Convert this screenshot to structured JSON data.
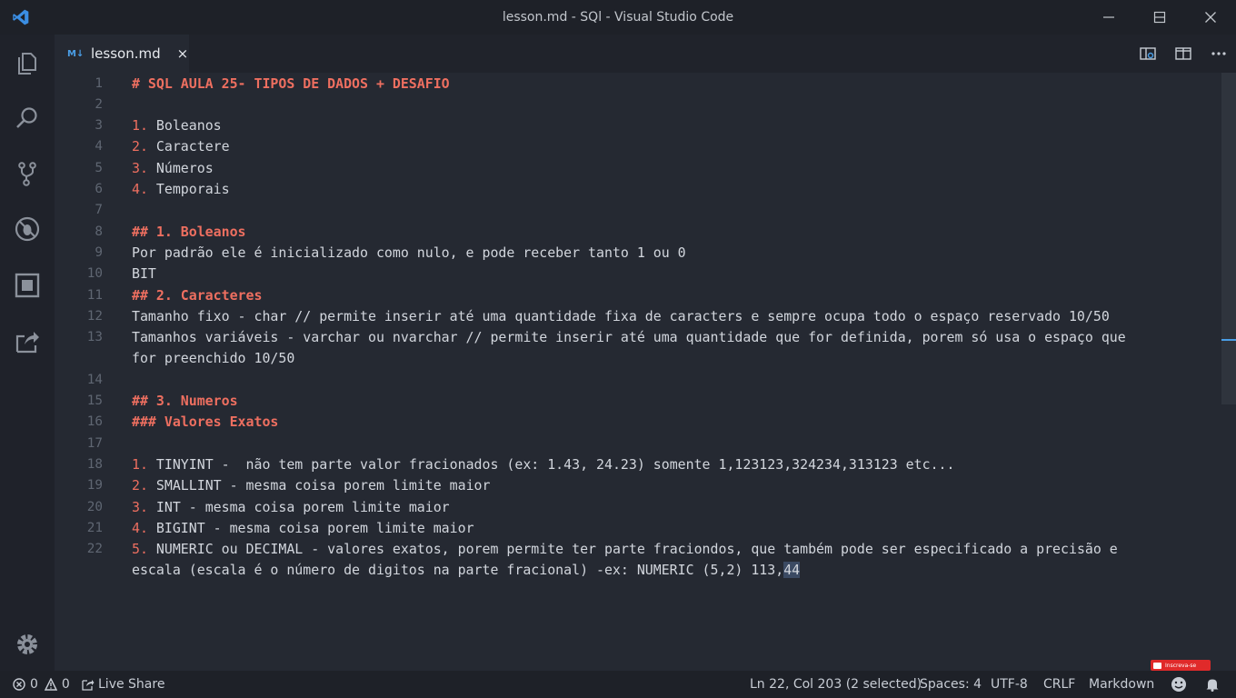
{
  "window": {
    "title": "lesson.md - SQl - Visual Studio Code"
  },
  "tab": {
    "icon": "M↓",
    "label": "lesson.md",
    "close": "×"
  },
  "lines": [
    {
      "n": "1",
      "segs": [
        {
          "t": "# SQL AULA 25- TIPOS DE DADOS + DESAFIO",
          "c": "hd"
        }
      ]
    },
    {
      "n": "2",
      "segs": []
    },
    {
      "n": "3",
      "segs": [
        {
          "t": "1.",
          "c": "lm"
        },
        {
          "t": " Boleanos",
          "c": ""
        }
      ]
    },
    {
      "n": "4",
      "segs": [
        {
          "t": "2.",
          "c": "lm"
        },
        {
          "t": " Caractere",
          "c": ""
        }
      ]
    },
    {
      "n": "5",
      "segs": [
        {
          "t": "3.",
          "c": "lm"
        },
        {
          "t": " Números",
          "c": ""
        }
      ]
    },
    {
      "n": "6",
      "segs": [
        {
          "t": "4.",
          "c": "lm"
        },
        {
          "t": " Temporais",
          "c": ""
        }
      ]
    },
    {
      "n": "7",
      "segs": []
    },
    {
      "n": "8",
      "segs": [
        {
          "t": "## 1. Boleanos",
          "c": "hd"
        }
      ]
    },
    {
      "n": "9",
      "segs": [
        {
          "t": "Por padrão ele é inicializado como nulo, e pode receber tanto 1 ou 0",
          "c": ""
        }
      ]
    },
    {
      "n": "10",
      "segs": [
        {
          "t": "BIT",
          "c": ""
        }
      ]
    },
    {
      "n": "11",
      "segs": [
        {
          "t": "## 2. Caracteres",
          "c": "hd"
        }
      ]
    },
    {
      "n": "12",
      "segs": [
        {
          "t": "Tamanho fixo - char // permite inserir até uma quantidade fixa de caracters e sempre ocupa todo o espaço reservado 10/50",
          "c": ""
        }
      ]
    },
    {
      "n": "13",
      "segs": [
        {
          "t": "Tamanhos variáveis - varchar ou nvarchar // permite inserir até uma quantidade que for definida, porem só usa o espaço que",
          "c": ""
        }
      ]
    },
    {
      "n": "",
      "segs": [
        {
          "t": "for preenchido 10/50",
          "c": ""
        }
      ]
    },
    {
      "n": "14",
      "segs": []
    },
    {
      "n": "15",
      "segs": [
        {
          "t": "## 3. Numeros",
          "c": "hd"
        }
      ]
    },
    {
      "n": "16",
      "segs": [
        {
          "t": "### Valores Exatos",
          "c": "hd"
        }
      ]
    },
    {
      "n": "17",
      "segs": []
    },
    {
      "n": "18",
      "segs": [
        {
          "t": "1.",
          "c": "lm"
        },
        {
          "t": " TINYINT -  não tem parte valor fracionados (ex: 1.43, 24.23) somente 1,123123,324234,313123 etc...",
          "c": ""
        }
      ]
    },
    {
      "n": "19",
      "segs": [
        {
          "t": "2.",
          "c": "lm"
        },
        {
          "t": " SMALLINT - mesma coisa porem limite maior",
          "c": ""
        }
      ]
    },
    {
      "n": "20",
      "segs": [
        {
          "t": "3.",
          "c": "lm"
        },
        {
          "t": " INT - mesma coisa porem limite maior",
          "c": ""
        }
      ]
    },
    {
      "n": "21",
      "segs": [
        {
          "t": "4.",
          "c": "lm"
        },
        {
          "t": " BIGINT - mesma coisa porem limite maior",
          "c": ""
        }
      ]
    },
    {
      "n": "22",
      "segs": [
        {
          "t": "5.",
          "c": "lm"
        },
        {
          "t": " NUMERIC ou DECIMAL - valores exatos, porem permite ter parte fraciondos, que também pode ser especificado a precisão e",
          "c": ""
        }
      ]
    },
    {
      "n": "",
      "segs": [
        {
          "t": "escala (escala é o número de digitos na parte fracional) -ex: NUMERIC (5,2) 113,",
          "c": ""
        },
        {
          "t": "44",
          "c": "sel"
        }
      ]
    }
  ],
  "status": {
    "errors": "0",
    "warnings": "0",
    "live_share": "Live Share",
    "position": "Ln 22, Col 203 (2 selected)",
    "spaces": "Spaces: 4",
    "encoding": "UTF-8",
    "eol": "CRLF",
    "language": "Markdown"
  },
  "badge": {
    "label": "Inscreva-se"
  },
  "colors": {
    "accent": "#4a9ee6",
    "heading": "#ee6f60",
    "background": "#252932"
  }
}
